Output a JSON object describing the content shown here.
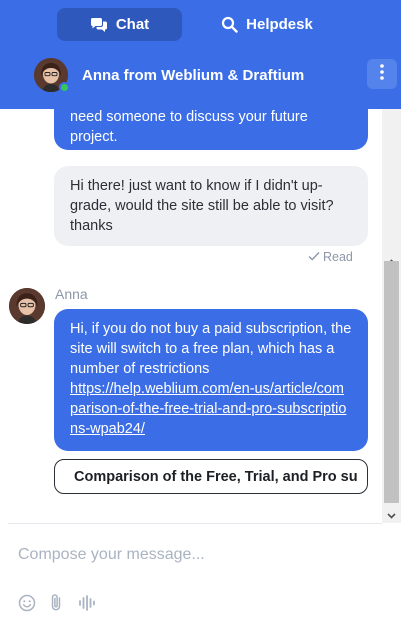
{
  "header": {
    "tabs": [
      {
        "label": "Chat",
        "icon": "chat-bubbles-icon",
        "active": true
      },
      {
        "label": "Helpdesk",
        "icon": "search-icon",
        "active": false
      }
    ],
    "agent_name": "Anna from Weblium & Draftium",
    "agent_status": "online"
  },
  "messages": {
    "items": [
      {
        "from": "agent",
        "text": "need someone to discuss your future project."
      },
      {
        "from": "user",
        "text": "Hi there! just want to know if I didn't up-grade, would the site still be able to visit? thanks"
      },
      {
        "from": "agent",
        "sender": "Anna",
        "text": "Hi, if you do not buy a paid subscription, the site will switch to a free plan, which has a number of restrictions",
        "link": "https://help.weblium.com/en-us/article/comparison-of-the-free-trial-and-pro-subscriptions-wpab24/"
      }
    ],
    "read_status": "Read",
    "card_button": "Comparison of the Free, Trial, and Pro su"
  },
  "composer": {
    "placeholder": "Compose your message..."
  },
  "colors": {
    "brand_blue": "#3b6ee6",
    "active_tab": "#2f58bd",
    "online_green": "#34c759",
    "bubble_gray": "#eef0f4"
  }
}
